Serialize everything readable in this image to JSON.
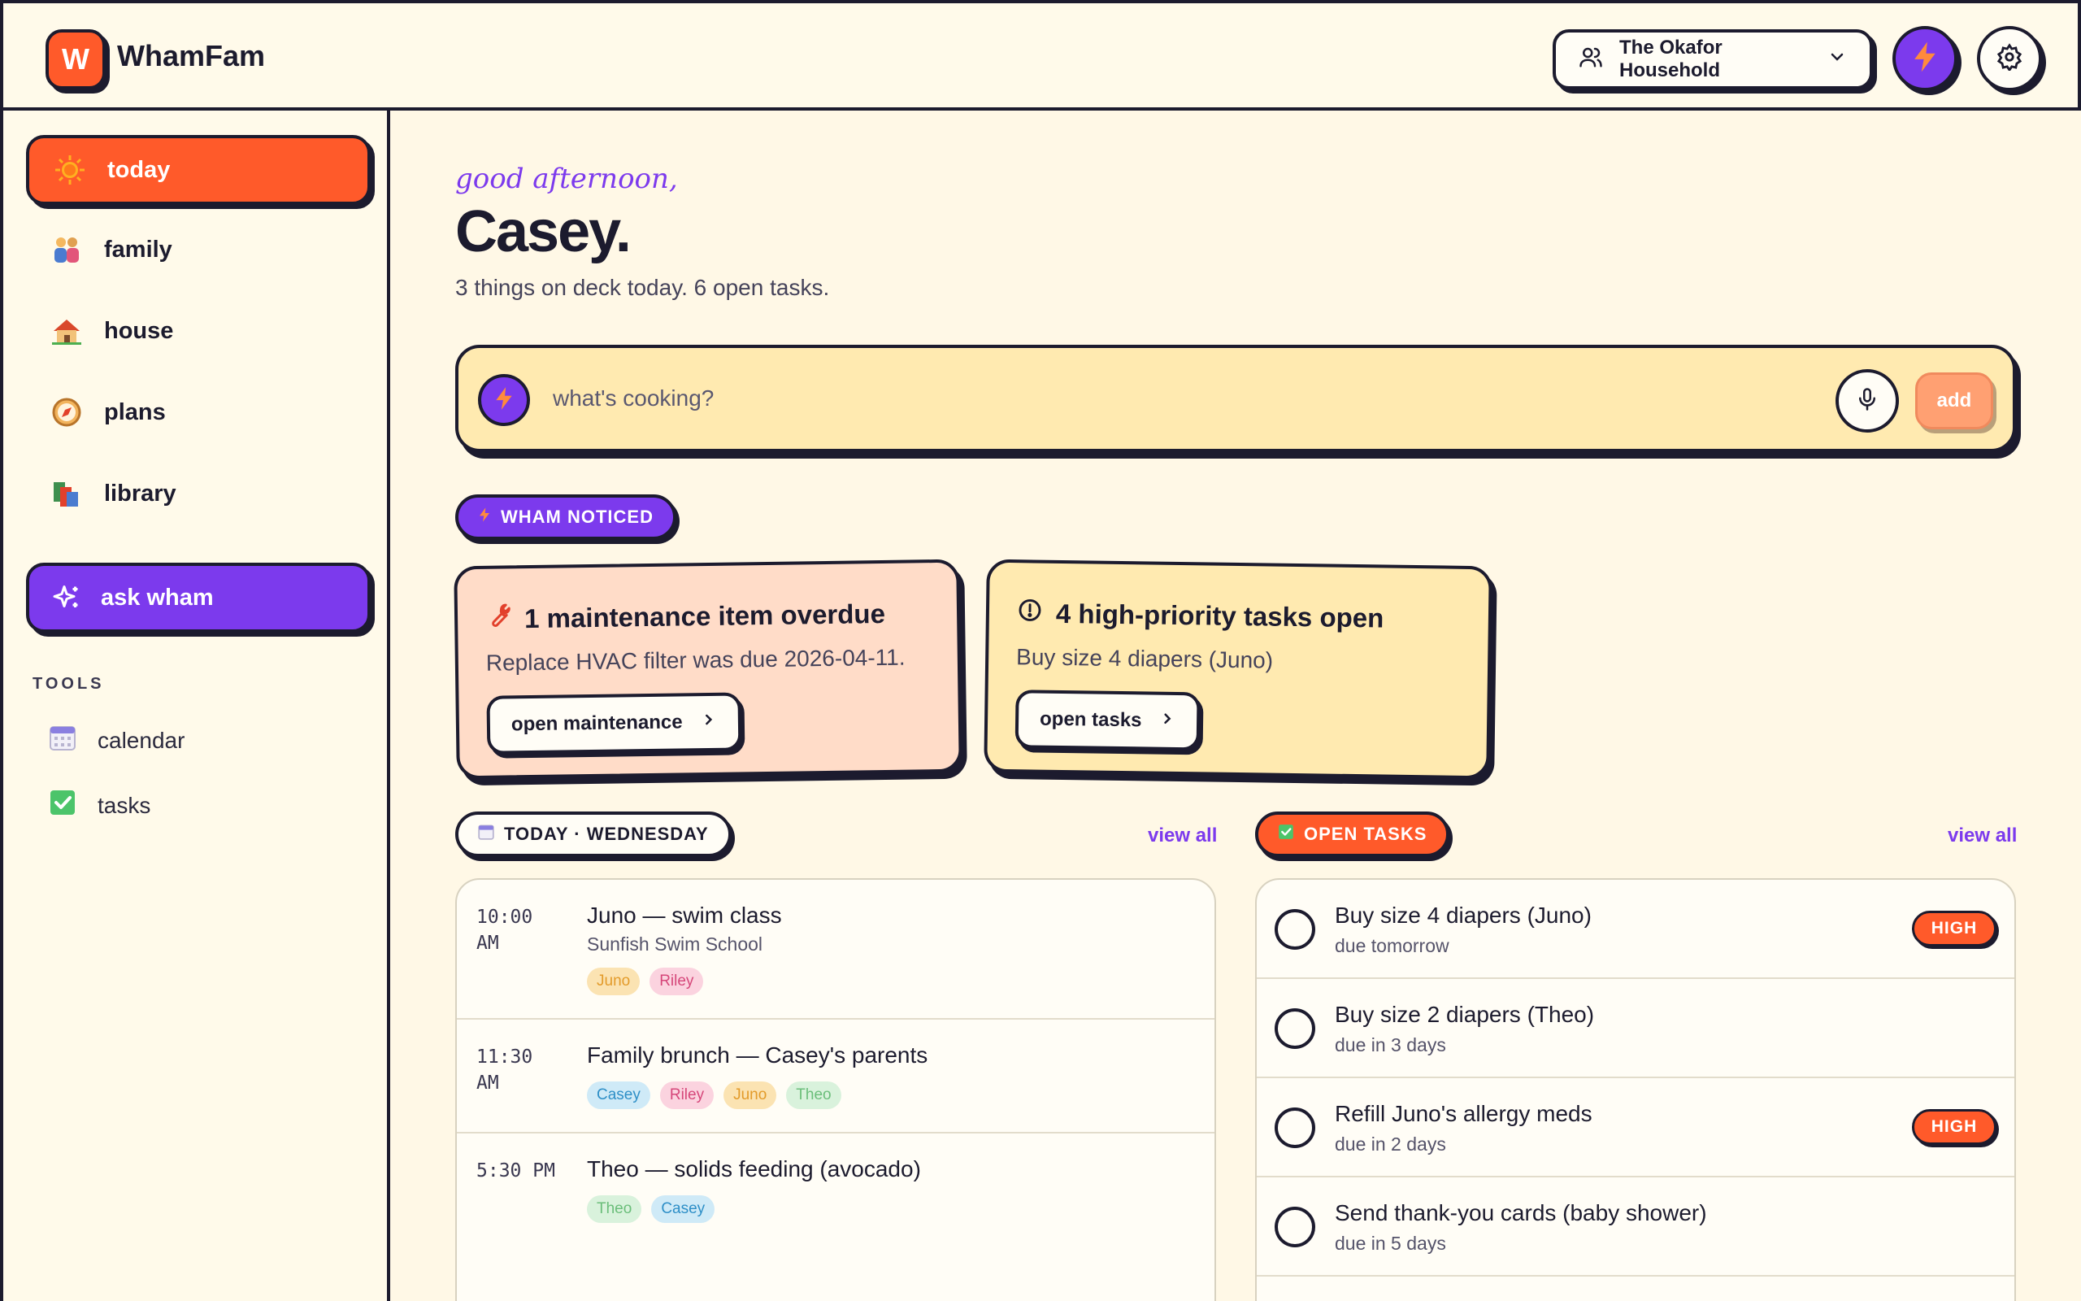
{
  "app": {
    "logo_letter": "W",
    "name": "WhamFam"
  },
  "header": {
    "household_label": "The Okafor Household"
  },
  "sidebar": {
    "items": [
      {
        "label": "today",
        "icon": "sun-icon"
      },
      {
        "label": "family",
        "icon": "family-icon"
      },
      {
        "label": "house",
        "icon": "house-icon"
      },
      {
        "label": "plans",
        "icon": "compass-icon"
      },
      {
        "label": "library",
        "icon": "books-icon"
      }
    ],
    "ask_label": "ask wham",
    "tools_heading": "TOOLS",
    "tools": [
      {
        "label": "calendar",
        "icon": "calendar-icon"
      },
      {
        "label": "tasks",
        "icon": "checkbox-icon"
      }
    ]
  },
  "greeting": {
    "salutation": "good afternoon,",
    "name": "Casey.",
    "summary": "3 things on deck today. 6 open tasks."
  },
  "composer": {
    "placeholder": "what's cooking?",
    "add_label": "add"
  },
  "noticed": {
    "badge": "WHAM NOTICED",
    "cards": [
      {
        "title": "1 maintenance item overdue",
        "body": "Replace HVAC filter was due 2026-04-11.",
        "button": "open maintenance",
        "icon": "wrench-icon"
      },
      {
        "title": "4 high-priority tasks open",
        "body": "Buy size 4 diapers (Juno)",
        "button": "open tasks",
        "icon": "alert-circle-icon"
      }
    ]
  },
  "today_section": {
    "badge": "TODAY · WEDNESDAY",
    "view_all": "view all",
    "events": [
      {
        "time": "10:00 AM",
        "title": "Juno — swim class",
        "subtitle": "Sunfish Swim School",
        "tags": [
          "Juno",
          "Riley"
        ]
      },
      {
        "time": "11:30 AM",
        "title": "Family brunch — Casey's parents",
        "subtitle": "",
        "tags": [
          "Casey",
          "Riley",
          "Juno",
          "Theo"
        ]
      },
      {
        "time": "5:30 PM",
        "title": "Theo — solids feeding (avocado)",
        "subtitle": "",
        "tags": [
          "Theo",
          "Casey"
        ]
      }
    ]
  },
  "tasks_section": {
    "badge": "OPEN TASKS",
    "view_all": "view all",
    "tasks": [
      {
        "title": "Buy size 4 diapers (Juno)",
        "due": "due tomorrow",
        "priority": "HIGH"
      },
      {
        "title": "Buy size 2 diapers (Theo)",
        "due": "due in 3 days",
        "priority": ""
      },
      {
        "title": "Refill Juno's allergy meds",
        "due": "due in 2 days",
        "priority": "HIGH"
      },
      {
        "title": "Send thank-you cards (baby shower)",
        "due": "due in 5 days",
        "priority": ""
      }
    ]
  },
  "colors": {
    "accent_orange": "#FF5A2A",
    "accent_purple": "#7C3AED",
    "background": "#FFF8E6",
    "ink": "#1C1B2E",
    "tag_juno": "#FBE3B2",
    "tag_riley": "#FBD3DF",
    "tag_casey": "#CFEAF7",
    "tag_theo": "#D9F2DC"
  }
}
